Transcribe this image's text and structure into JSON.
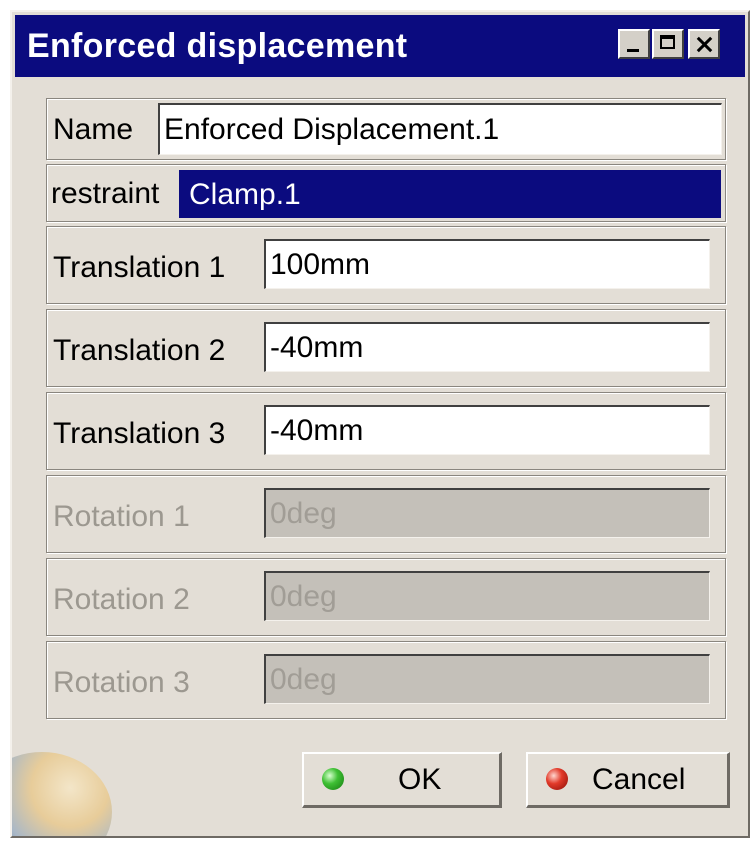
{
  "window": {
    "title": "Enforced displacement",
    "controls": [
      "minimize-icon",
      "maximize-icon",
      "close-icon"
    ]
  },
  "fields": {
    "name": {
      "label": "Name",
      "value": "Enforced Displacement.1"
    },
    "restraint": {
      "label": "restraint",
      "value": "Clamp.1"
    },
    "translation1": {
      "label": "Translation 1",
      "value": "100mm"
    },
    "translation2": {
      "label": "Translation 2",
      "value": "-40mm"
    },
    "translation3": {
      "label": "Translation 3",
      "value": "-40mm"
    },
    "rotation1": {
      "label": "Rotation 1",
      "value": "0deg",
      "enabled": false
    },
    "rotation2": {
      "label": "Rotation 2",
      "value": "0deg",
      "enabled": false
    },
    "rotation3": {
      "label": "Rotation 3",
      "value": "0deg",
      "enabled": false
    }
  },
  "buttons": {
    "ok": {
      "label": "OK",
      "icon": "green-dot-icon"
    },
    "cancel": {
      "label": "Cancel",
      "icon": "red-dot-icon"
    }
  },
  "colors": {
    "titlebar": "#0b0b7f",
    "selection": "#0b0b7f",
    "dialog_bg": "#e3ded6",
    "disabled_field": "#c4c0b9"
  }
}
